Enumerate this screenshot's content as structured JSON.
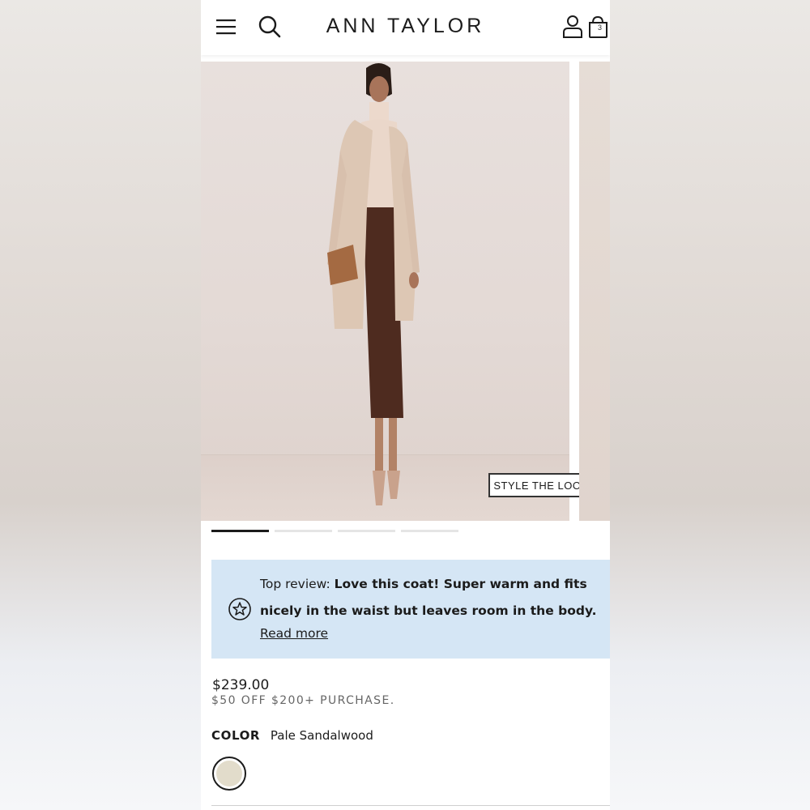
{
  "header": {
    "brand": "ANN TAYLOR",
    "bag_count": "3",
    "icons": [
      "menu-icon",
      "search-icon",
      "account-icon",
      "shopping-bag-icon"
    ]
  },
  "gallery": {
    "style_button": "STYLE THE LOOK",
    "slide_count": 4,
    "active_slide": 1
  },
  "review": {
    "label": "Top review:",
    "quote": "Love this coat! Super warm and fits nicely in the waist but leaves room in the body.",
    "read_more": "Read more",
    "icon": "star-icon"
  },
  "product": {
    "price": "$239.00",
    "promo": "$50 OFF $200+ PURCHASE.",
    "color_label": "COLOR",
    "color_value": "Pale Sandalwood",
    "swatch_color": "#e2dccb"
  }
}
